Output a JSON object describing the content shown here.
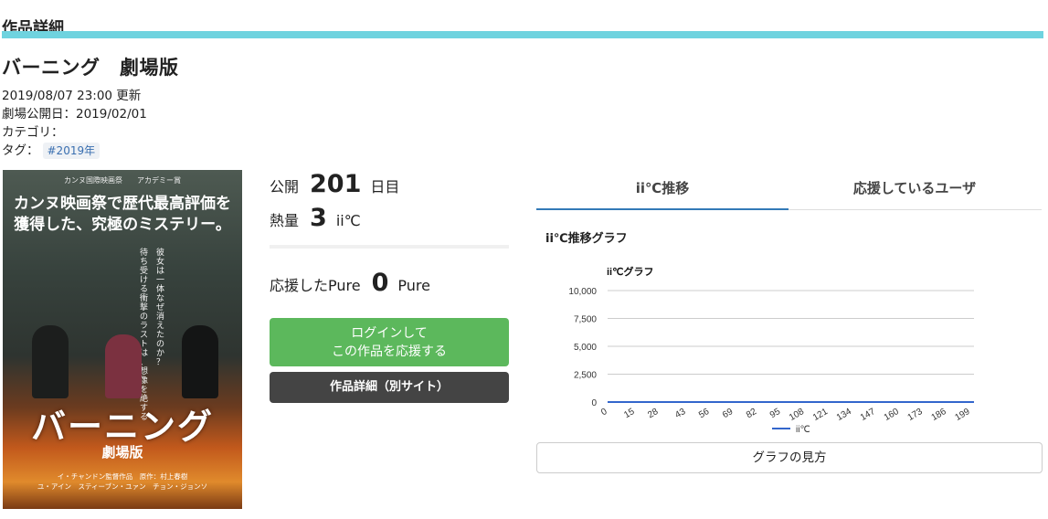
{
  "section": {
    "title": "作品詳細"
  },
  "work": {
    "title": "バーニング　劇場版",
    "updated": "2019/08/07 23:00 更新",
    "release_label": "劇場公開日：",
    "release_date": "2019/02/01",
    "category_label": "カテゴリ：",
    "tag_label": "タグ：",
    "tag": "#2019年"
  },
  "poster": {
    "laurels": "カンヌ国際映画祭　　アカデミー賞",
    "headline_1": "カンヌ映画祭で歴代最高評価を",
    "headline_2": "獲得した、究極のミステリー。",
    "vertical_1": "待ち受ける衝撃のラストは、想像を絶する",
    "vertical_2": "彼女は一体なぜ消えたのか？",
    "logo": "バーニング",
    "subtitle": "劇場版",
    "credit": "イ・チャンドン監督作品　原作：村上春樹\nユ・アイン　スティーブン・ユァン　チョン・ジョンソ"
  },
  "stats": {
    "days_label": "公開",
    "days_value": "201",
    "days_unit": "日目",
    "heat_label": "熱量",
    "heat_value": "3",
    "heat_unit": "ii℃",
    "pure_label": "応援したPure",
    "pure_value": "0",
    "pure_unit": "Pure"
  },
  "buttons": {
    "login_line1": "ログインして",
    "login_line2": "この作品を応援する",
    "detail": "作品詳細（別サイト）",
    "howto": "グラフの見方"
  },
  "tabs": [
    {
      "label": "ii℃推移",
      "active": true
    },
    {
      "label": "応援しているユーザ",
      "active": false
    }
  ],
  "graph": {
    "title": "ii℃推移グラフ"
  },
  "chart_data": {
    "type": "line",
    "title": "ii℃グラフ",
    "xlabel": "",
    "ylabel": "",
    "x_ticks": [
      0,
      15,
      28,
      43,
      56,
      69,
      82,
      95,
      108,
      121,
      134,
      147,
      160,
      173,
      186,
      199
    ],
    "y_ticks": [
      0,
      2500,
      5000,
      7500,
      10000
    ],
    "y_tick_labels": [
      "0",
      "2,500",
      "5,000",
      "7,500",
      "10,000"
    ],
    "xlim": [
      0,
      201
    ],
    "ylim": [
      0,
      10000
    ],
    "grid": true,
    "legend": "bottom",
    "series": [
      {
        "name": "ii℃",
        "color": "#3366cc",
        "x": [
          0,
          40,
          201
        ],
        "values": [
          0,
          3,
          3
        ]
      }
    ]
  },
  "colors": {
    "accent_bar": "#6fd3df",
    "login_green": "#5cb85c",
    "detail_dark": "#444444",
    "tab_active": "#337ab7",
    "tag_text": "#3a6fb0"
  }
}
